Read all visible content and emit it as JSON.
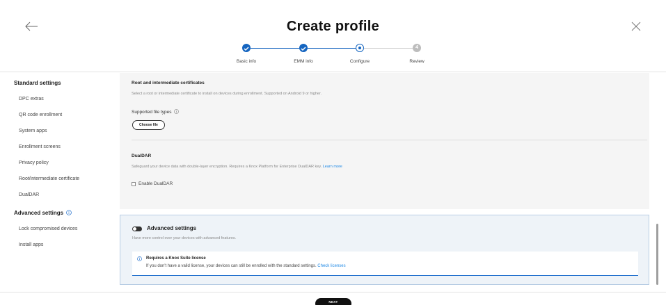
{
  "header": {
    "title": "Create profile",
    "back_icon": "arrow-left-icon",
    "close_icon": "close-icon"
  },
  "stepper": {
    "steps": [
      {
        "label": "Basic info",
        "state": "done"
      },
      {
        "label": "EMM info",
        "state": "done"
      },
      {
        "label": "Configure",
        "state": "current"
      },
      {
        "label": "Review",
        "state": "todo",
        "number": "4"
      }
    ],
    "colors": {
      "active": "#1565c0",
      "inactive": "#bdbdbd"
    }
  },
  "sidebar": {
    "standard_heading": "Standard settings",
    "standard_items": [
      "DPC extras",
      "QR code enrollment",
      "System apps",
      "Enrollment screens",
      "Privacy policy",
      "Root/intermediate certificate",
      "DualDAR"
    ],
    "advanced_heading": "Advanced settings",
    "advanced_items": [
      "Lock compromised devices",
      "Install apps"
    ]
  },
  "certificates": {
    "title": "Root and intermediate certificates",
    "description": "Select a root or intermediate certificate to install on devices during enrollment. Supported on Android 9 or higher.",
    "file_types_label": "Supported file types",
    "choose_file_label": "Choose file"
  },
  "dualdar": {
    "title": "DualDAR",
    "description": "Safeguard your device data with double-layer encryption. Requires a Knox Platform for Enterprise DualDAR key.",
    "learn_more": "Learn more",
    "checkbox_label": "Enable DualDAR",
    "checked": false
  },
  "advanced": {
    "title": "Advanced settings",
    "description": "Have more control over your devices with advanced features.",
    "toggle_on": false,
    "notice_title": "Requires a Knox Suite license",
    "notice_text": "If you don't have a valid license, your devices can still be enrolled with the standard settings.",
    "notice_link": "Check licenses"
  },
  "footer": {
    "next_label": "NEXT"
  },
  "colors": {
    "accent": "#1565c0",
    "link": "#1e88e5",
    "panel_bg": "#f5f5f5",
    "advanced_bg": "#eef3f8"
  }
}
